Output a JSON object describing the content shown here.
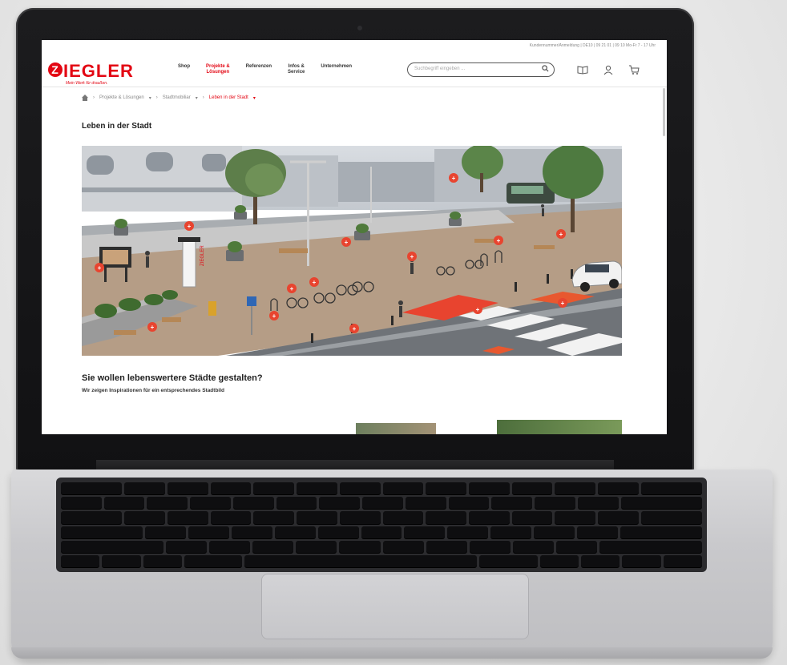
{
  "page": {
    "account_info": "Kundennummer/Anmeldung | DE10 | 09 21 01 | 09 10 Mo-Fr 7 - 17 Uhr"
  },
  "header": {
    "logo_text": "IEGLER",
    "logo_initial": "Z",
    "logo_tagline": "Mein Werk für draußen.",
    "nav": [
      {
        "label": "Shop",
        "active": false
      },
      {
        "label": "Projekte &\nLösungen",
        "active": true
      },
      {
        "label": "Referenzen",
        "active": false
      },
      {
        "label": "Infos &\nService",
        "active": false
      },
      {
        "label": "Unternehmen",
        "active": false
      }
    ],
    "search_placeholder": "Suchbegriff eingeben ...",
    "icons": [
      "catalog-icon",
      "account-icon",
      "cart-icon"
    ]
  },
  "breadcrumb": {
    "items": [
      "Projekte & Lösungen",
      "Stadtmobiliar",
      "Leben in der Stadt"
    ]
  },
  "main": {
    "title": "Leben in der Stadt",
    "section_title": "Sie wollen lebenswertere Städte gestalten?",
    "section_subtitle": "Wir zeigen Inspirationen für ein entsprechendes Stadtbild"
  },
  "scene": {
    "column_label": "ZIEGLER",
    "hotspot_symbol": "+",
    "accent_color": "#e30613"
  }
}
